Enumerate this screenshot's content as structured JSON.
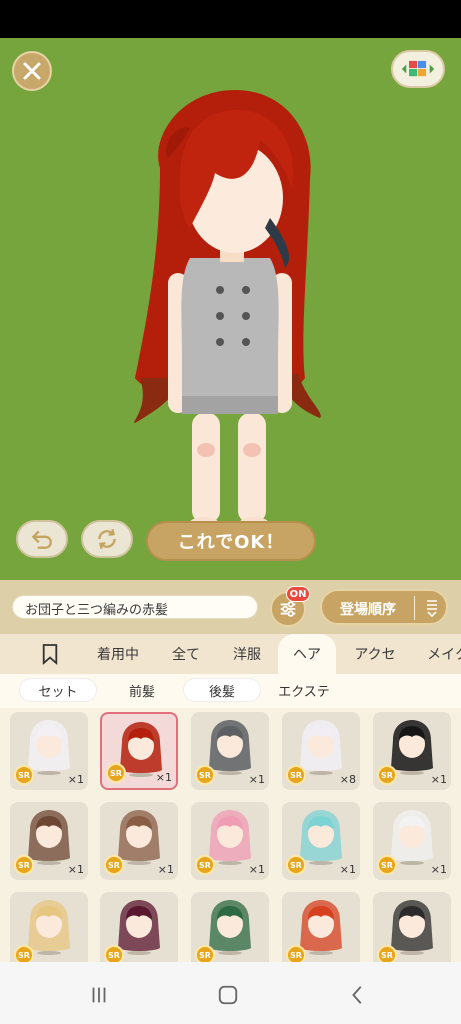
{
  "actions": {
    "ok_label": "これでOK！"
  },
  "search": {
    "value": "お団子と三つ編みの赤髪"
  },
  "filter": {
    "badge": "ON"
  },
  "sort": {
    "label": "登場順序"
  },
  "tabs": [
    {
      "label": "着用中"
    },
    {
      "label": "全て"
    },
    {
      "label": "洋服"
    },
    {
      "label": "ヘア"
    },
    {
      "label": "アクセ"
    },
    {
      "label": "メイク"
    }
  ],
  "subtabs": [
    {
      "label": "セット"
    },
    {
      "label": "前髪"
    },
    {
      "label": "後髪"
    },
    {
      "label": "エクステ"
    }
  ],
  "items": [
    {
      "rarity": "SR",
      "count": "×1",
      "hair": "#f2f0f5"
    },
    {
      "rarity": "SR",
      "count": "×1",
      "hair": "#b4200d"
    },
    {
      "rarity": "SR",
      "count": "×1",
      "hair": "#5d5f63"
    },
    {
      "rarity": "SR",
      "count": "×8",
      "hair": "#f0eef4"
    },
    {
      "rarity": "SR",
      "count": "×1",
      "hair": "#161616"
    },
    {
      "rarity": "SR",
      "count": "×1",
      "hair": "#6e4734"
    },
    {
      "rarity": "SR",
      "count": "×1",
      "hair": "#8a5d45"
    },
    {
      "rarity": "SR",
      "count": "×1",
      "hair": "#ef9cb5"
    },
    {
      "rarity": "SR",
      "count": "×1",
      "hair": "#7cd3d4"
    },
    {
      "rarity": "SR",
      "count": "×1",
      "hair": "#f2f2f2"
    },
    {
      "rarity": "SR",
      "count": "",
      "hair": "#e7c680"
    },
    {
      "rarity": "SR",
      "count": "",
      "hair": "#5a1730"
    },
    {
      "rarity": "SR",
      "count": "",
      "hair": "#2d6a43"
    },
    {
      "rarity": "SR",
      "count": "",
      "hair": "#d6401f"
    },
    {
      "rarity": "SR",
      "count": "",
      "hair": "#2b2b2b"
    }
  ],
  "colors": {
    "stage": "#76a43d",
    "accent": "#c8a464",
    "hair_main": "#c0230e"
  }
}
